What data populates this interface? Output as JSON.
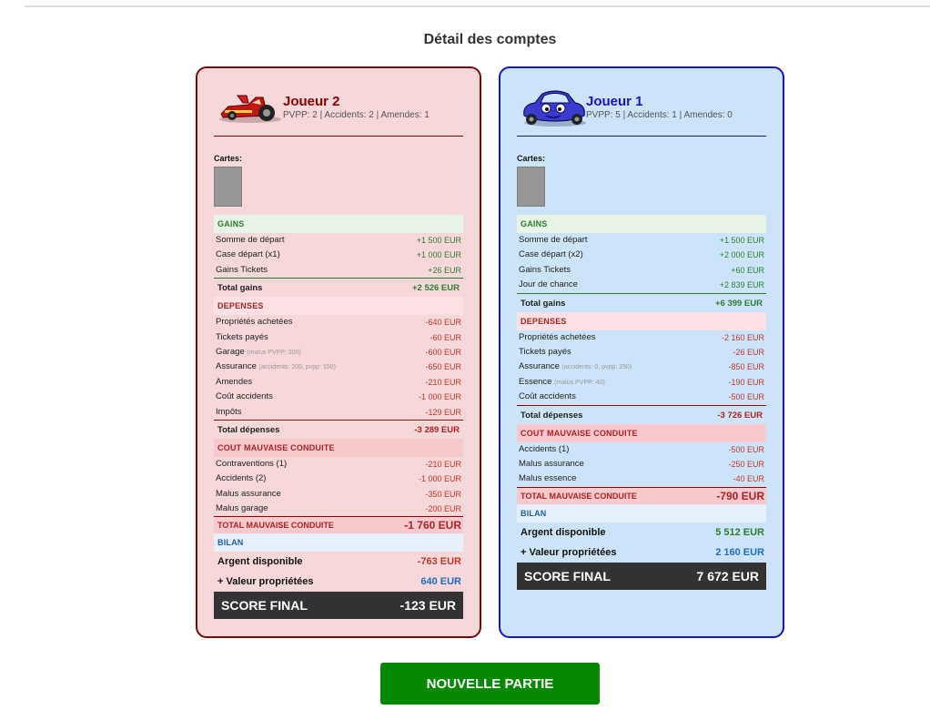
{
  "title": "Détail des comptes",
  "button_label": "NOUVELLE PARTIE",
  "players": [
    {
      "name": "Joueur 2",
      "stats": "PVPP: 2 | Accidents: 2 | Amendes: 1",
      "cartes_label": "Cartes:",
      "gains": {
        "label": "GAINS",
        "rows": [
          {
            "label": "Somme de départ",
            "note": "",
            "value": "+1 500 EUR"
          },
          {
            "label": "Case départ (x1)",
            "note": "",
            "value": "+1 000 EUR"
          },
          {
            "label": "Gains Tickets",
            "note": "",
            "value": "+26 EUR"
          }
        ],
        "total_label": "Total gains",
        "total_value": "+2 526 EUR"
      },
      "depenses": {
        "label": "DEPENSES",
        "rows": [
          {
            "label": "Propriétés achetées",
            "note": "",
            "value": "-640 EUR"
          },
          {
            "label": "Tickets payés",
            "note": "",
            "value": "-60 EUR"
          },
          {
            "label": "Garage",
            "note": "(malus PVPP: 200)",
            "value": "-600 EUR"
          },
          {
            "label": "Assurance",
            "note": "(accidents: 200, pvpp: 150)",
            "value": "-650 EUR"
          },
          {
            "label": "Amendes",
            "note": "",
            "value": "-210 EUR"
          },
          {
            "label": "Coût accidents",
            "note": "",
            "value": "-1 000 EUR"
          },
          {
            "label": "Impôts",
            "note": "",
            "value": "-129 EUR"
          }
        ],
        "total_label": "Total dépenses",
        "total_value": "-3 289 EUR"
      },
      "cmc": {
        "label": "COUT MAUVAISE CONDUITE",
        "rows": [
          {
            "label": "Contraventions (1)",
            "note": "",
            "value": "-210 EUR"
          },
          {
            "label": "Accidents (2)",
            "note": "",
            "value": "-1 000 EUR"
          },
          {
            "label": "Malus assurance",
            "note": "",
            "value": "-350 EUR"
          },
          {
            "label": "Malus garage",
            "note": "",
            "value": "-200 EUR"
          }
        ],
        "total_label": "TOTAL MAUVAISE CONDUITE",
        "total_value": "-1 760 EUR"
      },
      "bilan": {
        "label": "BILAN",
        "argent_label": "Argent disponible",
        "argent_value": "-763 EUR",
        "argent_color": "red",
        "valeur_label": "+ Valeur propriétées",
        "valeur_value": "640 EUR",
        "score_label": "SCORE FINAL",
        "score_value": "-123 EUR"
      }
    },
    {
      "name": "Joueur 1",
      "stats": "PVPP: 5 | Accidents: 1 | Amendes: 0",
      "cartes_label": "Cartes:",
      "gains": {
        "label": "GAINS",
        "rows": [
          {
            "label": "Somme de départ",
            "note": "",
            "value": "+1 500 EUR"
          },
          {
            "label": "Case départ (x2)",
            "note": "",
            "value": "+2 000 EUR"
          },
          {
            "label": "Gains Tickets",
            "note": "",
            "value": "+60 EUR"
          },
          {
            "label": "Jour de chance",
            "note": "",
            "value": "+2 839 EUR"
          }
        ],
        "total_label": "Total gains",
        "total_value": "+6 399 EUR"
      },
      "depenses": {
        "label": "DEPENSES",
        "rows": [
          {
            "label": "Propriétés achetées",
            "note": "",
            "value": "-2 160 EUR"
          },
          {
            "label": "Tickets payés",
            "note": "",
            "value": "-26 EUR"
          },
          {
            "label": "Assurance",
            "note": "(accidents: 0, pvpp: 250)",
            "value": "-850 EUR"
          },
          {
            "label": "Essence",
            "note": "(malus PVPP: 40)",
            "value": "-190 EUR"
          },
          {
            "label": "Coût accidents",
            "note": "",
            "value": "-500 EUR"
          }
        ],
        "total_label": "Total dépenses",
        "total_value": "-3 726 EUR"
      },
      "cmc": {
        "label": "COUT MAUVAISE CONDUITE",
        "rows": [
          {
            "label": "Accidents (1)",
            "note": "",
            "value": "-500 EUR"
          },
          {
            "label": "Malus assurance",
            "note": "",
            "value": "-250 EUR"
          },
          {
            "label": "Malus essence",
            "note": "",
            "value": "-40 EUR"
          }
        ],
        "total_label": "TOTAL MAUVAISE CONDUITE",
        "total_value": "-790 EUR"
      },
      "bilan": {
        "label": "BILAN",
        "argent_label": "Argent disponible",
        "argent_value": "5 512 EUR",
        "argent_color": "green",
        "valeur_label": "+ Valeur propriétées",
        "valeur_value": "2 160 EUR",
        "score_label": "SCORE FINAL",
        "score_value": "7 672 EUR"
      }
    }
  ]
}
